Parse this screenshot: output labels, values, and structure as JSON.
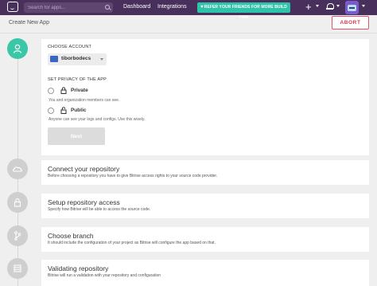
{
  "topbar": {
    "search_placeholder": "Search for apps...",
    "nav": [
      "Dashboard",
      "Integrations"
    ],
    "refer_label": "REFER YOUR FRIENDS FOR MORE BUILD TIME",
    "plus_symbol": "+",
    "colors": {
      "bar": "#492f5c",
      "refer": "#2fc3a9"
    }
  },
  "page": {
    "title": "Create New App",
    "abort_label": "ABORT",
    "abort_color": "#d8394f"
  },
  "choose_account": {
    "label": "CHOOSE ACCOUNT",
    "selected_account": "tiborbodecs"
  },
  "privacy": {
    "label": "SET PRIVACY OF THE APP",
    "options": [
      {
        "title": "Private",
        "description": "You and organization members can see.",
        "icon": "lock-icon"
      },
      {
        "title": "Public",
        "description": "Anyone can see your logs and configs. Use this wisely.",
        "icon": "unlock-icon"
      }
    ]
  },
  "next_label": "Next",
  "steps": [
    {
      "title": "Connect your repository",
      "description": "Before choosing a repository you have to give Bitrise access rights to your source code provider.",
      "icon": "cloud-icon"
    },
    {
      "title": "Setup repository access",
      "description": "Specify how Bitrise will be able to access the source code.",
      "icon": "lock-icon"
    },
    {
      "title": "Choose branch",
      "description": "It should include the configuration of your project as Bitrise will configure the app based on that.",
      "icon": "branch-icon"
    },
    {
      "title": "Validating repository",
      "description": "Bitrise will run a validation with your repository and configuration",
      "icon": "server-icon"
    }
  ],
  "accent_color": "#3ac7a8"
}
